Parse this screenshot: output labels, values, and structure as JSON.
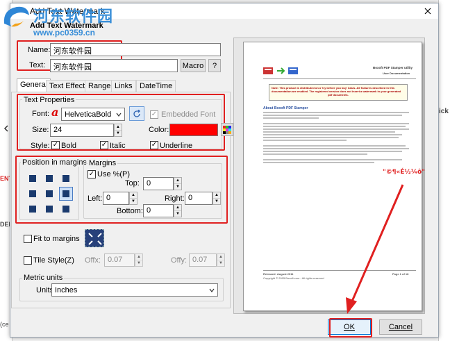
{
  "watermark_overlay": {
    "brand": "河东软件园",
    "url": "www.pc0359.cn"
  },
  "window": {
    "title": "Add Text Watermark",
    "inner_title": "Add Text Watermark"
  },
  "fields": {
    "name_label": "Name:",
    "name_value": "河东软件园",
    "text_label": "Text:",
    "text_value": "河东软件园",
    "macro_label": "Macro",
    "help_label": "?"
  },
  "tabs": [
    "General",
    "Text Effect",
    "Range",
    "Links",
    "DateTime"
  ],
  "text_properties": {
    "title": "Text Properties",
    "font_label": "Font:",
    "font_value": "HelveticaBold",
    "embedded_label": "Embedded Font",
    "size_label": "Size:",
    "size_value": "24",
    "color_label": "Color:",
    "color_value": "#ff0000",
    "style_label": "Style:",
    "bold_label": "Bold",
    "italic_label": "Italic",
    "underline_label": "Underline"
  },
  "position": {
    "title": "Position in margins"
  },
  "margins": {
    "title": "Margins",
    "use_pct_label": "Use %(P)",
    "top_label": "Top:",
    "top_value": "0",
    "left_label": "Left:",
    "left_value": "0",
    "right_label": "Right:",
    "right_value": "0",
    "bottom_label": "Bottom:",
    "bottom_value": "0"
  },
  "fit": {
    "label": "Fit to margins"
  },
  "tile": {
    "label": "Tile Style(Z)",
    "offx_label": "Offx:",
    "offx_value": "0.07",
    "offy_label": "Offy:",
    "offy_value": "0.07"
  },
  "metric": {
    "title": "Metric units",
    "units_label": "Units",
    "units_value": "Inches"
  },
  "preview": {
    "header1": "Boxoft PDF Stamper utility",
    "header2": "User Documentation",
    "note1": "Note: This product is distributed on a 'try before you buy' basis. All features described in this",
    "note2": "documentation are enabled. The registered version does not insert a watermark in your generated",
    "note3": "pdf documents.",
    "section": "About Boxoft PDF Stamper",
    "watermark_sample": "\"©¶«É½¼ô\"",
    "footer_left": "Released: August 2011",
    "footer_copy": "Copyright © 2005 Boxoft.com - All rights reserved",
    "footer_right": "Page 1 of 18"
  },
  "buttons": {
    "ok": "OK",
    "cancel": "Cancel"
  },
  "background": {
    "left_labels": [
      "ENT",
      "DEN",
      "(ce"
    ],
    "right_labels": [
      "ick"
    ]
  }
}
